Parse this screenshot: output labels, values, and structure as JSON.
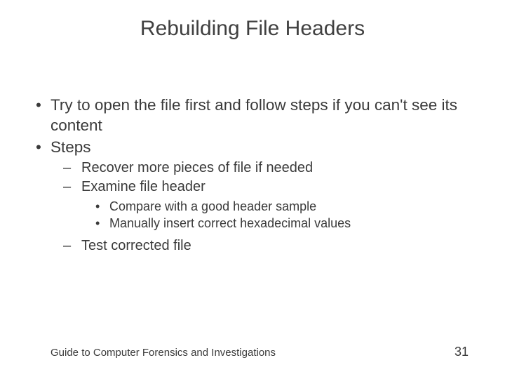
{
  "title": "Rebuilding File Headers",
  "bullets": {
    "b1": "Try to open the file first and follow steps if you can't see its content",
    "b2": "Steps",
    "s1": "Recover more pieces of file if needed",
    "s2": "Examine file header",
    "t1": "Compare with a good header sample",
    "t2": "Manually insert correct hexadecimal values",
    "s3": "Test corrected file"
  },
  "footer": {
    "left": "Guide to Computer Forensics and Investigations",
    "right": "31"
  }
}
